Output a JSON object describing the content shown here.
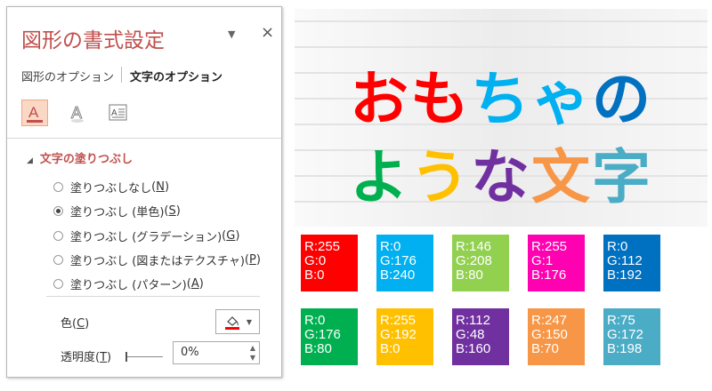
{
  "pane": {
    "title": "図形の書式設定",
    "dropdown_glyph": "▼",
    "close_glyph": "×",
    "tabs": {
      "shape_options": "図形のオプション",
      "text_options": "文字のオプション"
    },
    "section": {
      "toggle_glyph": "◢",
      "label": "文字の塗りつぶし"
    },
    "fill_options": [
      {
        "label": "塗りつぶしなし",
        "key": "N",
        "checked": false
      },
      {
        "label": "塗りつぶし (単色)",
        "key": "S",
        "checked": true
      },
      {
        "label": "塗りつぶし (グラデーション)",
        "key": "G",
        "checked": false
      },
      {
        "label": "塗りつぶし (図またはテクスチャ)",
        "key": "P",
        "checked": false
      },
      {
        "label": "塗りつぶし (パターン)",
        "key": "A",
        "checked": false
      }
    ],
    "color": {
      "label": "色",
      "key": "C",
      "swatch": "#ff0000"
    },
    "transparency": {
      "label": "透明度",
      "key": "T",
      "value": "0%"
    }
  },
  "banner": {
    "line1": [
      {
        "char": "お",
        "color": "#ff0000"
      },
      {
        "char": "も",
        "color": "#ff0000"
      },
      {
        "char": "ち",
        "color": "#00b0f0"
      },
      {
        "char": "ゃ",
        "color": "#00b0f0"
      },
      {
        "char": "の",
        "color": "#0070c0"
      }
    ],
    "line2": [
      {
        "char": "よ",
        "color": "#00b050"
      },
      {
        "char": "う",
        "color": "#ffc000"
      },
      {
        "char": "な",
        "color": "#7030a0"
      },
      {
        "char": "文",
        "color": "#f79646"
      },
      {
        "char": "字",
        "color": "#4bacc6"
      }
    ]
  },
  "swatches": [
    {
      "r": "R:255",
      "g": "G:0",
      "b": "B:0",
      "color": "#ff0000"
    },
    {
      "r": "R:0",
      "g": "G:176",
      "b": "B:240",
      "color": "#00b0f0"
    },
    {
      "r": "R:146",
      "g": "G:208",
      "b": "B:80",
      "color": "#92d050"
    },
    {
      "r": "R:255",
      "g": "G:1",
      "b": "B:176",
      "color": "#ff01b0"
    },
    {
      "r": "R:0",
      "g": "G:112",
      "b": "B:192",
      "color": "#0070c0"
    },
    {
      "r": "R:0",
      "g": "G:176",
      "b": "B:80",
      "color": "#00b050"
    },
    {
      "r": "R:255",
      "g": "G:192",
      "b": "B:0",
      "color": "#ffc000"
    },
    {
      "r": "R:112",
      "g": "G:48",
      "b": "B:160",
      "color": "#7030a0"
    },
    {
      "r": "R:247",
      "g": "G:150",
      "b": "B:70",
      "color": "#f79646"
    },
    {
      "r": "R:75",
      "g": "G:172",
      "b": "B:198",
      "color": "#4bacc6"
    }
  ]
}
